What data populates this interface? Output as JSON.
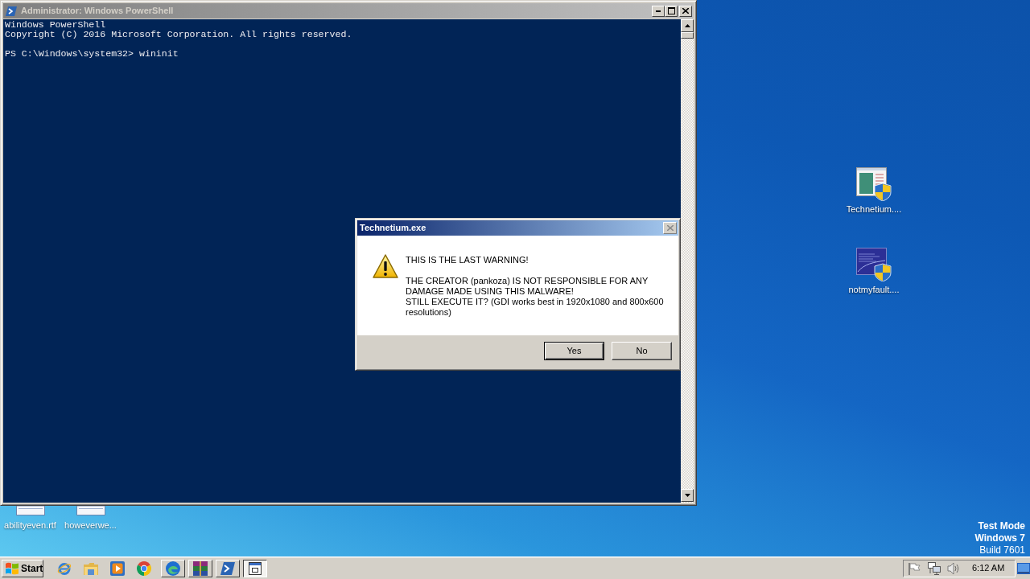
{
  "desktop": {
    "icons": [
      {
        "label": "Technetium....",
        "kind": "window"
      },
      {
        "label": "notmyfault....",
        "kind": "screen"
      }
    ],
    "partly_hidden_icons": [
      {
        "label": "abilityeven.rtf",
        "kind": "document"
      },
      {
        "label": "howeverwe...",
        "kind": "document"
      }
    ],
    "system_watermark": [
      {
        "text": "Test Mode",
        "bold": true
      },
      {
        "text": "Windows 7",
        "bold": true
      },
      {
        "text": "Build 7601",
        "bold": false
      }
    ]
  },
  "powershell_window": {
    "title": "Administrator: Windows PowerShell",
    "active": false,
    "console_blocks": [
      [
        "Windows PowerShell",
        "Copyright (C) 2016 Microsoft Corporation. All rights reserved."
      ],
      [
        "PS C:\\Windows\\system32> wininit"
      ]
    ]
  },
  "dialog": {
    "title": "Technetium.exe",
    "active": true,
    "message_blocks": [
      [
        "THIS IS THE LAST WARNING!"
      ],
      [
        "THE CREATOR (pankoza) IS NOT RESPONSIBLE FOR ANY DAMAGE MADE USING THIS MALWARE!",
        "STILL EXECUTE IT? (GDI works best in 1920x1080 and 800x600 resolutions)"
      ]
    ],
    "buttons": [
      {
        "label": "Yes",
        "default": true
      },
      {
        "label": "No",
        "default": false
      }
    ]
  },
  "taskbar": {
    "start_label": "Start",
    "buttons": [
      {
        "selected": false
      },
      {
        "selected": false
      },
      {
        "selected": false
      },
      {
        "selected": true
      }
    ],
    "clock": "6:12 AM"
  }
}
